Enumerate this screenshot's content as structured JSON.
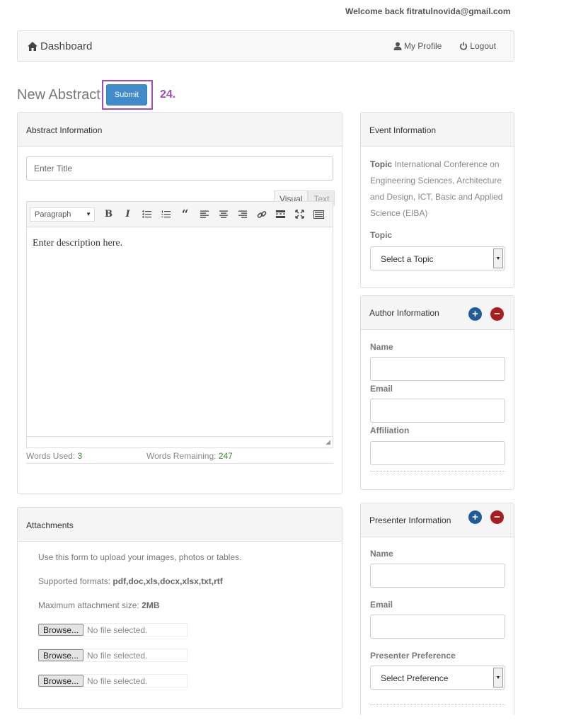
{
  "header": {
    "welcome": "Welcome back fitratulnovida@gmail.com"
  },
  "navbar": {
    "brand": "Dashboard",
    "links": [
      {
        "label": "My Profile",
        "icon": "user-icon"
      },
      {
        "label": "Logout",
        "icon": "power-icon"
      }
    ]
  },
  "page": {
    "title": "New Abstract",
    "submit_label": "Submit",
    "step_label": "24."
  },
  "abstract": {
    "heading": "Abstract Information",
    "title_placeholder": "Enter Title",
    "tabs": {
      "visual": "Visual",
      "text": "Text"
    },
    "format": "Paragraph",
    "description": "Enter description here.",
    "words_used_label": "Words Used:",
    "words_used": "3",
    "words_remaining_label": "Words Remaining:",
    "words_remaining": "247"
  },
  "attachments": {
    "heading": "Attachments",
    "intro": "Use this form to upload your images, photos or tables.",
    "formats_label": "Supported formats:",
    "formats": "pdf,doc,xls,docx,xlsx,txt,rtf",
    "max_label": "Maximum attachment size:",
    "max": "2MB",
    "browse_label": "Browse...",
    "file_status": "No file selected."
  },
  "event": {
    "heading": "Event Information",
    "topic_label_inline": "Topic",
    "topic_text": "International Conference on Engineering Sciences, Architecture and Design, ICT, Basic and Applied Science (EIBA)",
    "topic_field_label": "Topic",
    "topic_select": "Select a Topic"
  },
  "author": {
    "heading": "Author Information",
    "name_label": "Name",
    "email_label": "Email",
    "affiliation_label": "Affiliation"
  },
  "presenter": {
    "heading": "Presenter Information",
    "name_label": "Name",
    "email_label": "Email",
    "preference_label": "Presenter Preference",
    "preference_select": "Select Preference"
  },
  "colors": {
    "primary": "#428bca",
    "highlight": "#a24cb5",
    "add": "#1f5c99",
    "remove": "#a81d1d",
    "count": "#3c8c2c"
  }
}
